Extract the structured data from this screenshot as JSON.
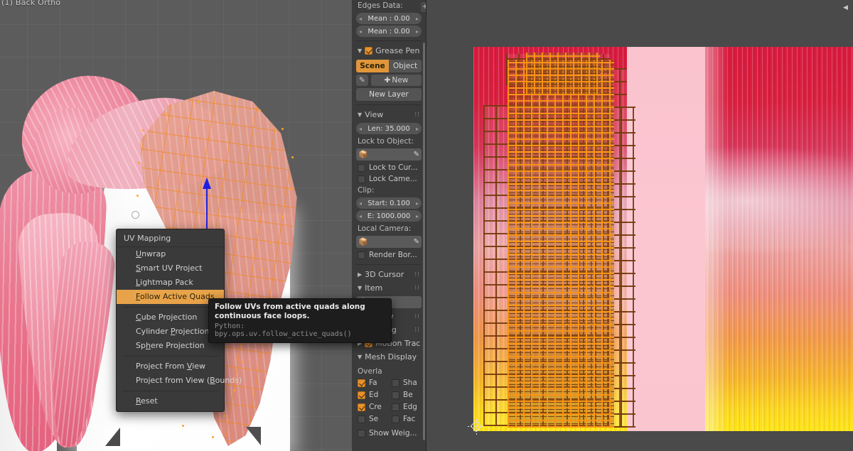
{
  "viewport3d": {
    "overlay_text": "(1) Back Ortho",
    "scene_description": "Pink-haired character model in Edit Mode with orange selected mesh faces"
  },
  "properties_panel": {
    "edges_data": {
      "label": "Edges Data:",
      "fields": [
        {
          "name": "Mean :",
          "value": "0.00"
        },
        {
          "name": "Mean :",
          "value": "0.00"
        }
      ]
    },
    "grease_pencil": {
      "header": "Grease Pen",
      "checked": true,
      "tabs": [
        {
          "label": "Scene",
          "active": true
        },
        {
          "label": "Object",
          "active": false
        }
      ],
      "new_button": "New",
      "new_layer_button": "New Layer"
    },
    "view": {
      "header": "View",
      "lens": {
        "label": "Len:",
        "value": "35.000"
      },
      "lock_to_object_label": "Lock to Object:",
      "lock_to_object_value": "",
      "lock_to_cursor": {
        "label": "Lock to Cur...",
        "checked": false
      },
      "lock_camera": {
        "label": "Lock Came...",
        "checked": false
      },
      "clip_label": "Clip:",
      "clip_start": {
        "label": "Start:",
        "value": "0.100"
      },
      "clip_end": {
        "label": "E:",
        "value": "1000.000"
      },
      "local_camera_label": "Local Camera:",
      "local_camera_value": "",
      "render_border": {
        "label": "Render Bor...",
        "checked": false
      }
    },
    "cursor_3d": {
      "header": "3D Cursor"
    },
    "item": {
      "header": "Item"
    },
    "display": {
      "header": "Display"
    },
    "shading": {
      "header": "Shading"
    },
    "motion_tracking": {
      "header": "Motion Trac",
      "checked": true
    },
    "mesh_display": {
      "header": "Mesh Display",
      "overlays_label": "Overla",
      "overlays": [
        {
          "label": "Fa",
          "checked": true
        },
        {
          "label": "Sha",
          "checked": false
        },
        {
          "label": "Ed",
          "checked": true
        },
        {
          "label": "Be",
          "checked": false
        },
        {
          "label": "Cre",
          "checked": true
        },
        {
          "label": "Edg",
          "checked": false
        },
        {
          "label": "Se",
          "checked": false
        },
        {
          "label": "Fac",
          "checked": false
        }
      ],
      "show_weights": {
        "label": "Show Weig...",
        "checked": false
      }
    },
    "expand_icon": "+"
  },
  "uv_editor": {
    "texture_description": "Pink hair texture with vertical strand striations, crimson to orange-yellow gradient",
    "cursor_label": "2D Cursor",
    "collapse_icon": "◀",
    "colors": {
      "top": "#d81b3f",
      "midtone": "#ef8f7f",
      "bottom": "#ffe518",
      "band": "#fac3ce",
      "wire_dark": "#763a0c",
      "wire_bright": "#fa9614"
    }
  },
  "uv_mapping_menu": {
    "title": "UV Mapping",
    "items": [
      {
        "label": "Unwrap",
        "accel": "U",
        "selected": false,
        "separator_after": false
      },
      {
        "label": "Smart UV Project",
        "accel": "S",
        "selected": false,
        "separator_after": false
      },
      {
        "label": "Lightmap Pack",
        "accel": "L",
        "selected": false,
        "separator_after": false
      },
      {
        "label": "Follow Active Quads",
        "accel": "F",
        "selected": true,
        "separator_after": true
      },
      {
        "label": "Cube Projection",
        "accel": "C",
        "selected": false,
        "separator_after": false
      },
      {
        "label": "Cylinder Projection",
        "accel": "P",
        "selected": false,
        "separator_after": false
      },
      {
        "label": "Sphere Projection",
        "accel": "h",
        "selected": false,
        "separator_after": true
      },
      {
        "label": "Project From View",
        "accel": "V",
        "selected": false,
        "separator_after": false
      },
      {
        "label": "Project from View (Bounds)",
        "accel": "B",
        "selected": false,
        "separator_after": true
      },
      {
        "label": "Reset",
        "accel": "R",
        "selected": false,
        "separator_after": false
      }
    ],
    "highlight_color": "#e8a34a"
  },
  "tooltip": {
    "description": "Follow UVs from active quads along continuous face loops.",
    "python": "Python: bpy.ops.uv.follow_active_quads()"
  }
}
